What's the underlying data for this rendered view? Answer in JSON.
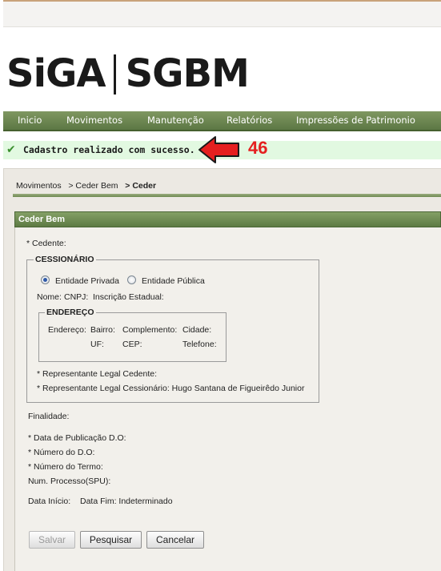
{
  "logo": {
    "part1": "SiGA",
    "part2": "SGBM"
  },
  "menu": [
    "Inicio",
    "Movimentos",
    "Manutenção",
    "Relatórios",
    "Impressões de Patrimonio"
  ],
  "message": {
    "text": "Cadastro realizado com sucesso.",
    "icon": "check-icon",
    "annotation": "46"
  },
  "breadcrumb": {
    "items": [
      "Movimentos",
      "> Ceder Bem"
    ],
    "current": "> Ceder"
  },
  "panel": {
    "title": "Ceder Bem"
  },
  "form": {
    "cedente": "* Cedente:",
    "cessionario": {
      "legend": "CESSIONÁRIO",
      "options": [
        "Entidade Privada",
        "Entidade Pública"
      ],
      "selected": "Entidade Privada",
      "nome": "Nome:",
      "cnpj": "CNPJ:",
      "inscricao": "Inscrição Estadual:",
      "endereco": {
        "legend": "ENDEREÇO",
        "endereco": "Endereço:",
        "bairro": "Bairro:",
        "complemento": "Complemento:",
        "cidade": "Cidade:",
        "uf": "UF:",
        "cep": "CEP:",
        "telefone": "Telefone:"
      },
      "rep_cedente": "* Representante Legal Cedente:",
      "rep_cessionario": "* Representante Legal Cessionário: Hugo Santana de Figueirêdo Junior"
    },
    "finalidade": "Finalidade:",
    "data_publicacao": "* Data de Publicação D.O:",
    "numero_do": "* Número do D.O:",
    "numero_termo": "* Número do Termo:",
    "num_processo": "Num. Processo(SPU):",
    "data_inicio": "Data Início:",
    "data_fim": "Data Fim: Indeterminado"
  },
  "buttons": {
    "salvar": "Salvar",
    "pesquisar": "Pesquisar",
    "cancelar": "Cancelar"
  },
  "colors": {
    "menu": "#6d8650",
    "success_bg": "#e2f9e1",
    "annotation": "#e5201f"
  }
}
